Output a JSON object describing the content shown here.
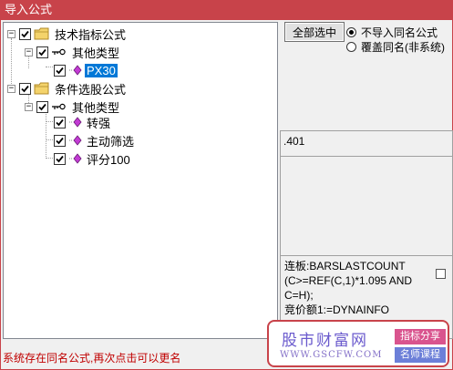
{
  "window": {
    "title": "导入公式"
  },
  "tree": {
    "nodes": [
      {
        "label": "技术指标公式",
        "level": 0,
        "expander": "−",
        "checked": true,
        "icon": "folder-icon"
      },
      {
        "label": "其他类型",
        "level": 1,
        "expander": "−",
        "checked": true,
        "icon": "key-icon"
      },
      {
        "label": "PX30",
        "level": 2,
        "checked": true,
        "icon": "formula-diamond-icon",
        "selected": true
      },
      {
        "label": "条件选股公式",
        "level": 0,
        "expander": "−",
        "checked": true,
        "icon": "folder-icon"
      },
      {
        "label": "其他类型",
        "level": 1,
        "expander": "−",
        "checked": true,
        "icon": "key-icon"
      },
      {
        "label": "转强",
        "level": 2,
        "checked": true,
        "icon": "formula-diamond-icon"
      },
      {
        "label": "主动筛选",
        "level": 2,
        "checked": true,
        "icon": "formula-diamond-icon"
      },
      {
        "label": "评分100",
        "level": 2,
        "checked": true,
        "icon": "formula-diamond-icon"
      }
    ]
  },
  "options": {
    "select_all_label": "全部选中",
    "radio_no_import": "不导入同名公式",
    "radio_overwrite": "覆盖同名(非系统)",
    "selected": "no_import"
  },
  "info": {
    "text": ".401"
  },
  "formula": {
    "lines": [
      "连板:BARSLASTCOUNT",
      "(C>=REF(C,1)*1.095 AND",
      "C=H);",
      "竞价额1:=DYNAINFO"
    ]
  },
  "status": {
    "text": "系统存在同名公式,再次点击可以更名"
  },
  "watermark": {
    "title": "股市财富网",
    "url": "WWW.GSCFW.COM",
    "tag1": "指标分享",
    "tag2": "名师课程"
  },
  "colors": {
    "titlebar": "#c8434a",
    "selection": "#0078d7",
    "status_text": "#c00000"
  }
}
